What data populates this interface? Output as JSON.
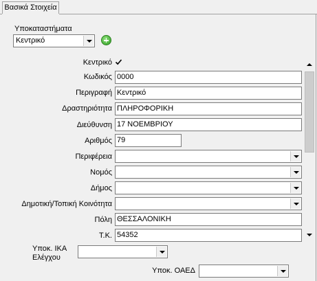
{
  "tab": {
    "label": "Βασικά Στοιχεία"
  },
  "branches": {
    "label": "Υποκαταστήματα",
    "selected": "Κεντρικό"
  },
  "form": {
    "central_label": "Κεντρικό",
    "central_checked": true,
    "code_label": "Κωδικός",
    "code_value": "0000",
    "description_label": "Περιγραφή",
    "description_value": "Κεντρικό",
    "activity_label": "Δραστηριότητα",
    "activity_value": "ΠΛΗΡΟΦΟΡΙΚΗ",
    "address_label": "Διεύθυνση",
    "address_value": "17 ΝΟΕΜΒΡΙΟΥ",
    "number_label": "Αριθμός",
    "number_value": "79",
    "region_label": "Περιφέρεια",
    "region_value": "",
    "prefecture_label": "Νομός",
    "prefecture_value": "",
    "municipality_label": "Δήμος",
    "municipality_value": "",
    "community_label": "Δημοτική/Τοπική Κοινότητα",
    "community_value": "",
    "city_label": "Πόλη",
    "city_value": "ΘΕΣΣΑΛΟΝΙΚΗ",
    "postal_label": "Τ.Κ.",
    "postal_value": "54352"
  },
  "ika": {
    "label_line1": "Υποκ. ΙΚΑ",
    "label_line2": "Ελέγχου",
    "value": ""
  },
  "oaed": {
    "label": "Υποκ. ΟΑΕΔ",
    "value": ""
  },
  "icons": {
    "add": "add-circle-icon",
    "check": "check-icon"
  }
}
